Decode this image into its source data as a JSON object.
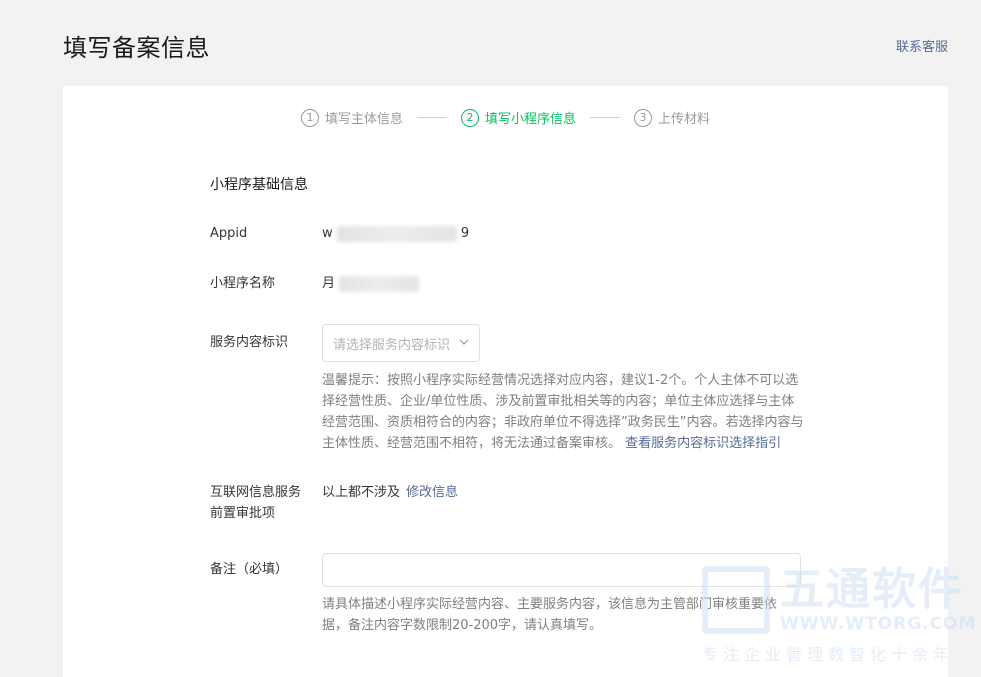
{
  "header": {
    "title": "填写备案信息",
    "contact_label": "联系客服"
  },
  "steps": [
    {
      "num": "1",
      "label": "填写主体信息"
    },
    {
      "num": "2",
      "label": "填写小程序信息"
    },
    {
      "num": "3",
      "label": "上传材料"
    }
  ],
  "section": {
    "title": "小程序基础信息"
  },
  "fields": {
    "appid": {
      "label": "Appid",
      "value_prefix": "w",
      "value_suffix": "9"
    },
    "name": {
      "label": "小程序名称",
      "value_prefix": "月"
    },
    "service": {
      "label": "服务内容标识",
      "placeholder": "请选择服务内容标识",
      "hint": "温馨提示：按照小程序实际经营情况选择对应内容，建议1-2个。个人主体不可以选择经营性质、企业/单位性质、涉及前置审批相关等的内容；单位主体应选择与主体经营范围、资质相符合的内容；非政府单位不得选择”政务民生”内容。若选择内容与主体性质、经营范围不相符，将无法通过备案审核。 ",
      "hint_link": "查看服务内容标识选择指引"
    },
    "approval": {
      "label": "互联网信息服务前置审批项",
      "value": "以上都不涉及",
      "edit_label": "修改信息"
    },
    "remark": {
      "label": "备注（必填）",
      "value": "",
      "hint": "请具体描述小程序实际经营内容、主要服务内容，该信息为主管部门审核重要依据，备注内容字数限制20-200字，请认真填写。"
    }
  },
  "watermark": {
    "name": "五通软件",
    "url": "WWW.WTORG.COM",
    "slogan": "专注企业管理数智化十余年"
  }
}
